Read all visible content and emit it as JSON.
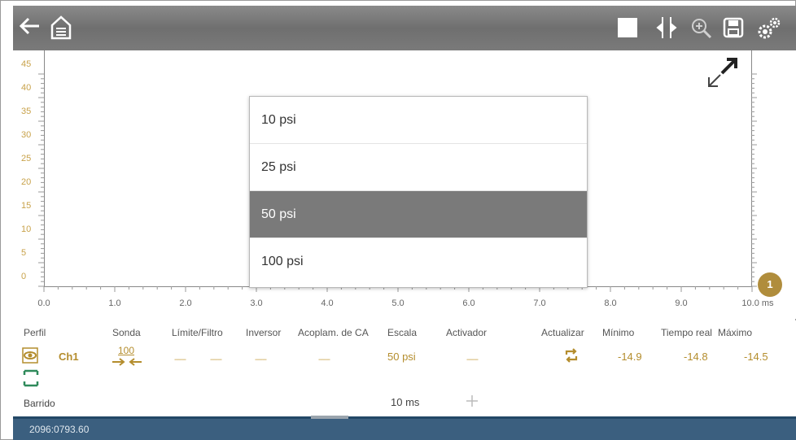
{
  "toolbar": {
    "icons": [
      "back-arrow-icon",
      "home-icon",
      "stop-square-icon",
      "cursor-icon",
      "zoom-icon",
      "save-icon",
      "settings-icon"
    ]
  },
  "plot": {
    "y_ticks": [
      "45",
      "40",
      "35",
      "30",
      "25",
      "20",
      "15",
      "10",
      "5",
      "0"
    ],
    "x_ticks": [
      "0.0",
      "1.0",
      "2.0",
      "3.0",
      "4.0",
      "5.0",
      "6.0",
      "7.0",
      "8.0",
      "9.0",
      "10.0 ms"
    ],
    "channel_badge": "1"
  },
  "dropdown": {
    "options": [
      "10 psi",
      "25 psi",
      "50 psi",
      "100 psi"
    ],
    "selected": "50 psi"
  },
  "panel": {
    "headers": {
      "perfil": "Perfil",
      "sonda": "Sonda",
      "limite": "Límite/Filtro",
      "inversor": "Inversor",
      "acoplam": "Acoplam. de CA",
      "escala": "Escala",
      "activador": "Activador",
      "actualizar": "Actualizar",
      "minimo": "Mínimo",
      "tiempo_real": "Tiempo real",
      "maximo": "Máximo"
    },
    "channel": "Ch1",
    "probe_value": "100",
    "scale": "50 psi",
    "minimo": "-14.9",
    "tiempo_real": "-14.8",
    "maximo": "-14.5",
    "barrido_label": "Barrido",
    "barrido_value": "10 ms",
    "placeholder_dash": "------"
  },
  "status": {
    "text": "2096:0793.60"
  },
  "colors": {
    "accent": "#b08d3c",
    "toolbar": "#7a7a7a",
    "statusbar": "#3b5f7f",
    "selected": "#7a7a7a"
  }
}
